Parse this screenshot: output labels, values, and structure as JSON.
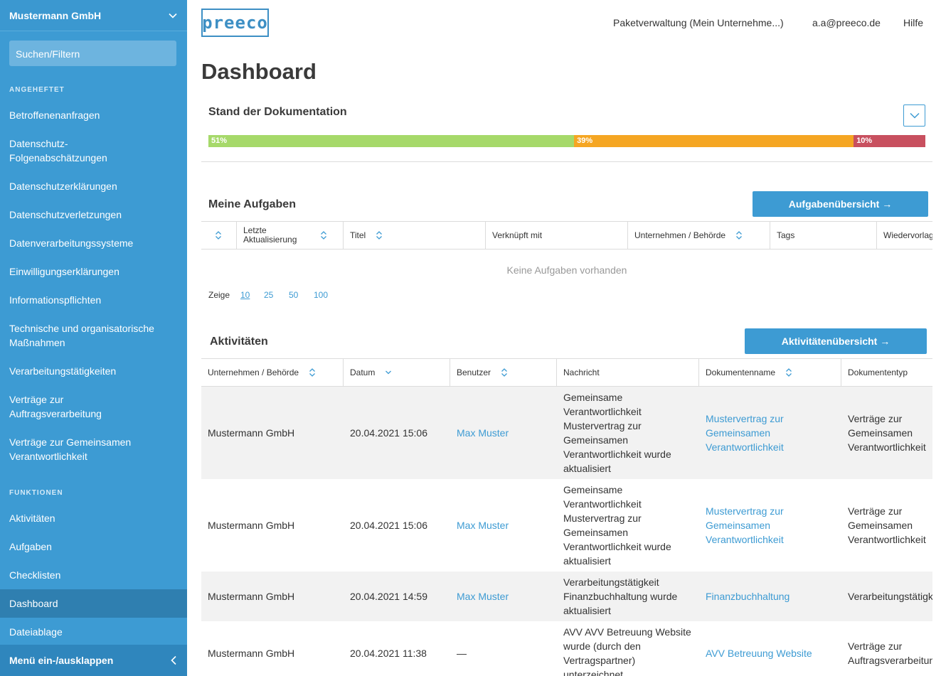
{
  "sidebar": {
    "company": "Mustermann GmbH",
    "search_label": "Suchen/Filtern",
    "pinned_label": "ANGEHEFTET",
    "pinned": [
      "Betroffenenanfragen",
      "Datenschutz-\nFolgenabschätzungen",
      "Datenschutzerklärungen",
      "Datenschutzverletzungen",
      "Datenverarbeitungssysteme",
      "Einwilligungserklärungen",
      "Informationspflichten",
      "Technische und organisatorische Maßnahmen",
      "Verarbeitungstätigkeiten",
      "Verträge zur Auftragsverarbeitung",
      "Verträge zur Gemeinsamen Verantwortlichkeit"
    ],
    "functions_label": "FUNKTIONEN",
    "functions": [
      "Aktivitäten",
      "Aufgaben",
      "Checklisten",
      "Dashboard",
      "Dateiablage"
    ],
    "active": "Dashboard",
    "toggle_label": "Menü ein-/ausklappen"
  },
  "header": {
    "logo": "preeco",
    "package": "Paketverwaltung (Mein Unternehme...)",
    "user": "a.a@preeco.de",
    "help": "Hilfe"
  },
  "page_title": "Dashboard",
  "documentation": {
    "title": "Stand der Dokumentation",
    "segments": [
      {
        "label": "51%",
        "value": 51,
        "color": "#a6d96a"
      },
      {
        "label": "39%",
        "value": 39,
        "color": "#f5a623"
      },
      {
        "label": "10%",
        "value": 10,
        "color": "#c8505f"
      }
    ]
  },
  "tasks": {
    "title": "Meine Aufgaben",
    "button": "Aufgabenübersicht →",
    "headers": [
      "",
      "Letzte Aktualisierung",
      "Titel",
      "Verknüpft mit",
      "Unternehmen / Behörde",
      "Tags",
      "Wiedervorlage"
    ],
    "empty": "Keine Aufgaben vorhanden",
    "pager_label": "Zeige",
    "pager_options": [
      "10",
      "25",
      "50",
      "100"
    ]
  },
  "activities": {
    "title": "Aktivitäten",
    "button": "Aktivitätenübersicht →",
    "headers": [
      "Unternehmen / Behörde",
      "Datum",
      "Benutzer",
      "Nachricht",
      "Dokumentenname",
      "Dokumententyp"
    ],
    "rows": [
      {
        "company": "Mustermann GmbH",
        "date": "20.04.2021 15:06",
        "user": "Max Muster",
        "message": "Gemeinsame Verantwortlichkeit Mustervertrag zur Gemeinsamen Verantwortlichkeit wurde aktualisiert",
        "doc": "Mustervertrag zur Gemeinsamen Verantwortlichkeit",
        "type": "Verträge zur Gemeinsamen Verantwortlichkeit"
      },
      {
        "company": "Mustermann GmbH",
        "date": "20.04.2021 15:06",
        "user": "Max Muster",
        "message": "Gemeinsame Verantwortlichkeit Mustervertrag zur Gemeinsamen Verantwortlichkeit wurde aktualisiert",
        "doc": "Mustervertrag zur Gemeinsamen Verantwortlichkeit",
        "type": "Verträge zur Gemeinsamen Verantwortlichkeit"
      },
      {
        "company": "Mustermann GmbH",
        "date": "20.04.2021 14:59",
        "user": "Max Muster",
        "message": "Verarbeitungstätigkeit Finanzbuchhaltung wurde aktualisiert",
        "doc": "Finanzbuchhaltung",
        "type": "Verarbeitungstätigkeiten"
      },
      {
        "company": "Mustermann GmbH",
        "date": "20.04.2021 11:38",
        "user": "—",
        "message": "AVV AVV Betreuung Website wurde (durch den Vertragspartner) unterzeichnet",
        "doc": "AVV Betreuung Website",
        "type": "Verträge zur Auftragsverarbeitung"
      }
    ]
  }
}
